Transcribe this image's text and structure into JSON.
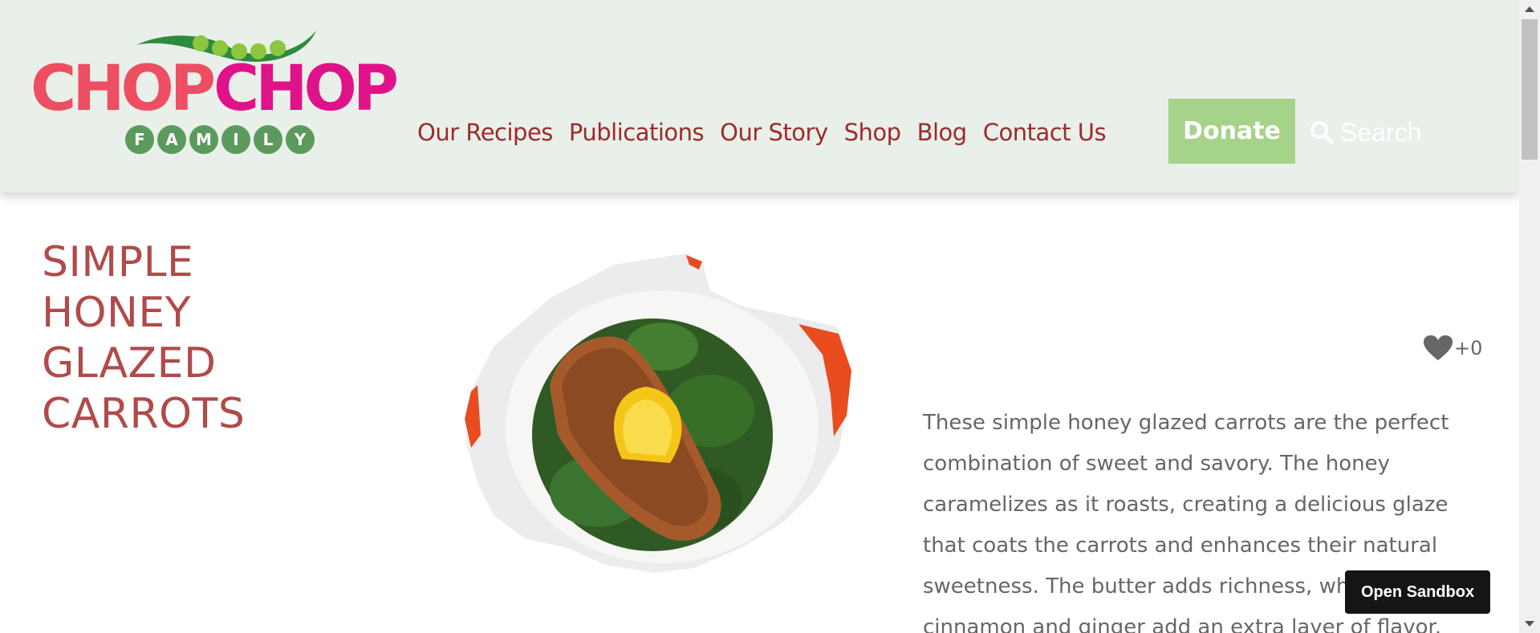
{
  "header": {
    "logo": {
      "word_left": "CHOP",
      "word_right": "CHOP",
      "family_letters": [
        "F",
        "A",
        "M",
        "I",
        "L",
        "Y"
      ],
      "colors": {
        "chop_left": "#ee4e62",
        "chop_right": "#e0128a",
        "family": "#5b9a5c",
        "pod": "#8dc63f"
      }
    },
    "nav": [
      {
        "label": "Our Recipes"
      },
      {
        "label": "Publications"
      },
      {
        "label": "Our Story"
      },
      {
        "label": "Shop"
      },
      {
        "label": "Blog"
      },
      {
        "label": "Contact Us"
      }
    ],
    "donate_label": "Donate",
    "search": {
      "placeholder": "Search",
      "icon": "search-icon"
    },
    "colors": {
      "background": "#e8f0e9",
      "nav_text": "#9e2a2b",
      "donate_bg": "#a5d38a"
    }
  },
  "recipe": {
    "title": "Simple Honey Glazed Carrots",
    "image_icon": "plated-salmon-on-greens-image",
    "likes": {
      "icon": "heart-icon",
      "count": "+0"
    },
    "description": "These simple honey glazed carrots are the perfect combination of sweet and savory. The honey caramelizes as it roasts, creating a delicious glaze that coats the carrots and enhances their natural sweetness. The butter adds richness, while cinnamon and ginger add an extra layer of flavor.",
    "colors": {
      "title": "#b14a4a",
      "body_text": "#666666"
    }
  },
  "sandbox_button_label": "Open Sandbox"
}
